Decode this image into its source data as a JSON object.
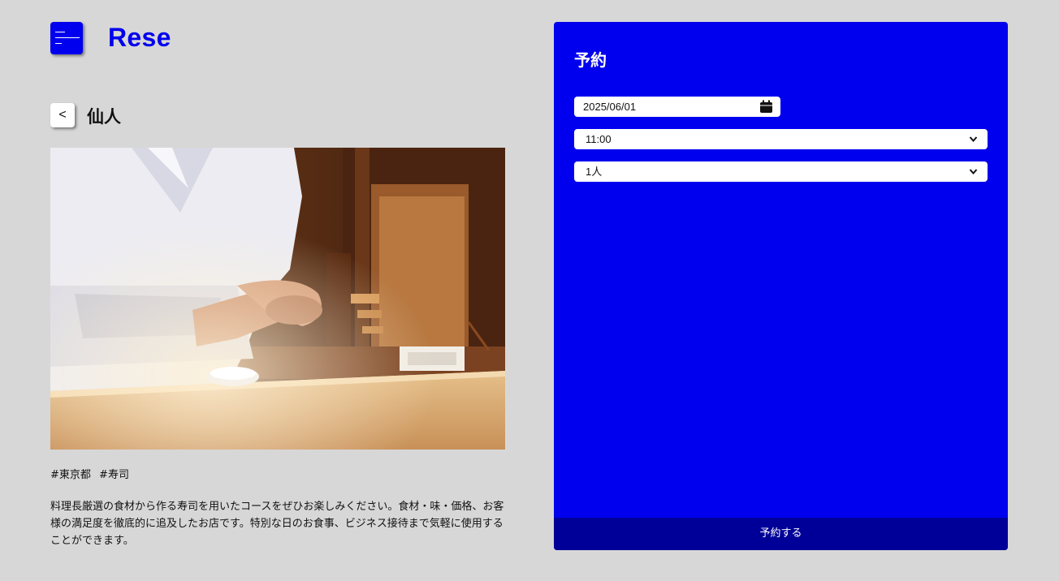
{
  "header": {
    "logo": "Rese",
    "menu_icon": "hamburger-menu-icon"
  },
  "shop": {
    "back_label": "<",
    "name": "仙人",
    "image_alt": "sushi chef at wooden counter",
    "tags": [
      "#東京都",
      "#寿司"
    ],
    "description": "料理長厳選の食材から作る寿司を用いたコースをぜひお楽しみください。食材・味・価格、お客様の満足度を徹底的に追及したお店です。特別な日のお食事、ビジネス接待まで気軽に使用することができます。"
  },
  "reservation": {
    "title": "予約",
    "date": "2025/06/01",
    "time": "11:00",
    "number": "1人",
    "submit_label": "予約する"
  },
  "colors": {
    "accent": "#0000ee",
    "submit_bg": "#000099",
    "page_bg": "#d7d7d7"
  }
}
